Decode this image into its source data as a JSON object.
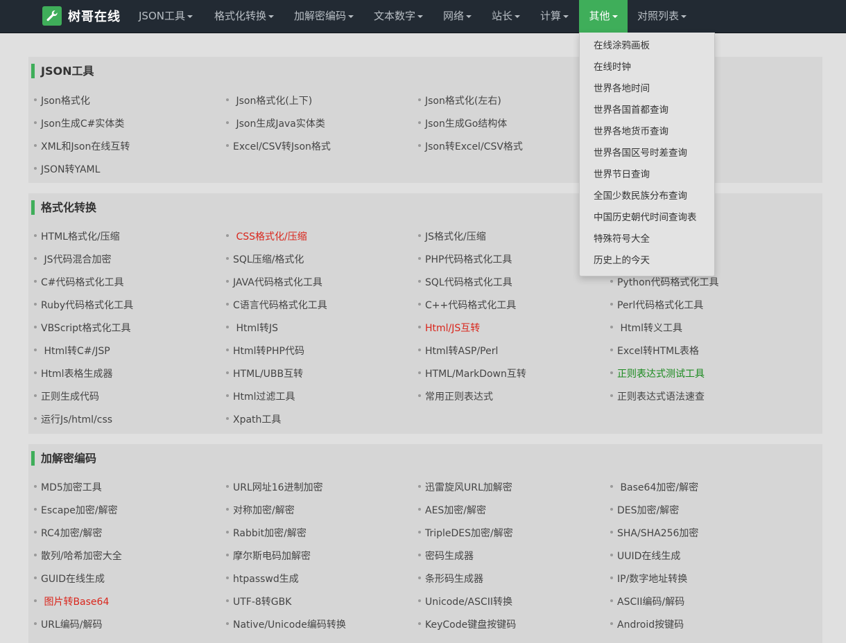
{
  "brand": {
    "name": "树哥在线",
    "color": "#3fae5a"
  },
  "nav": {
    "items": [
      "JSON工具",
      "格式化转换",
      "加解密编码",
      "文本数字",
      "网络",
      "站长",
      "计算",
      "其他",
      "对照列表"
    ],
    "active": "其他"
  },
  "dropdown": {
    "items": [
      "在线涂鸦画板",
      "在线时钟",
      "世界各地时间",
      "世界各国首都查询",
      "世界各地货币查询",
      "世界各国区号时差查询",
      "世界节日查询",
      "全国少数民族分布查询",
      "中国历史朝代时间查询表",
      "特殊符号大全",
      "历史上的今天"
    ]
  },
  "sections": [
    {
      "title": "JSON工具",
      "items": [
        "Json格式化",
        "Json格式化(上下)",
        "Json格式化(左右)",
        "",
        "Json生成C#实体类",
        "Json生成Java实体类",
        "Json生成Go结构体",
        "",
        "XML和Json在线互转",
        "Excel/CSV转Json格式",
        "Json转Excel/CSV格式",
        "",
        "JSON转YAML"
      ]
    },
    {
      "title": "格式化转换",
      "items": [
        "HTML格式化/压缩",
        "CSS格式化/压缩",
        "JS格式化/压缩",
        "",
        "JS代码混合加密",
        "SQL压缩/格式化",
        "PHP代码格式化工具",
        "",
        "C#代码格式化工具",
        "JAVA代码格式化工具",
        "SQL代码格式化工具",
        "Python代码格式化工具",
        "Ruby代码格式化工具",
        "C语言代码格式化工具",
        "C++代码格式化工具",
        "Perl代码格式化工具",
        "VBScript格式化工具",
        "Html转JS",
        "Html/JS互转",
        "Html转义工具",
        "Html转C#/JSP",
        "Html转PHP代码",
        "Html转ASP/Perl",
        "Excel转HTML表格",
        "Html表格生成器",
        "HTML/UBB互转",
        "HTML/MarkDown互转",
        "正则表达式测试工具",
        "正则生成代码",
        "Html过滤工具",
        "常用正则表达式",
        "正则表达式语法速查",
        "运行Js/html/css",
        "Xpath工具"
      ],
      "highlight_red": [
        "CSS格式化/压缩",
        "Html/JS互转"
      ],
      "highlight_green": [
        "正则表达式测试工具"
      ]
    },
    {
      "title": "加解密编码",
      "items": [
        "MD5加密工具",
        "URL网址16进制加密",
        "迅雷旋风URL加解密",
        "Base64加密/解密",
        "Escape加密/解密",
        "对称加密/解密",
        "AES加密/解密",
        "DES加密/解密",
        "RC4加密/解密",
        "Rabbit加密/解密",
        "TripleDES加密/解密",
        "SHA/SHA256加密",
        "散列/哈希加密大全",
        "摩尔斯电码加解密",
        "密码生成器",
        "UUID在线生成",
        "GUID在线生成",
        "htpasswd生成",
        "条形码生成器",
        "IP/数字地址转换",
        "图片转Base64",
        "UTF-8转GBK",
        "Unicode/ASCII转换",
        "ASCII编码/解码",
        "URL编码/解码",
        "Native/Unicode编码转换",
        "KeyCode键盘按键码",
        "Android按键码"
      ],
      "highlight_red": [
        "图片转Base64"
      ]
    }
  ],
  "colors": {
    "navbar": "#222a33",
    "accent": "#3fae5a",
    "link_red": "#d9261c",
    "link_green": "#1a8a1e"
  }
}
